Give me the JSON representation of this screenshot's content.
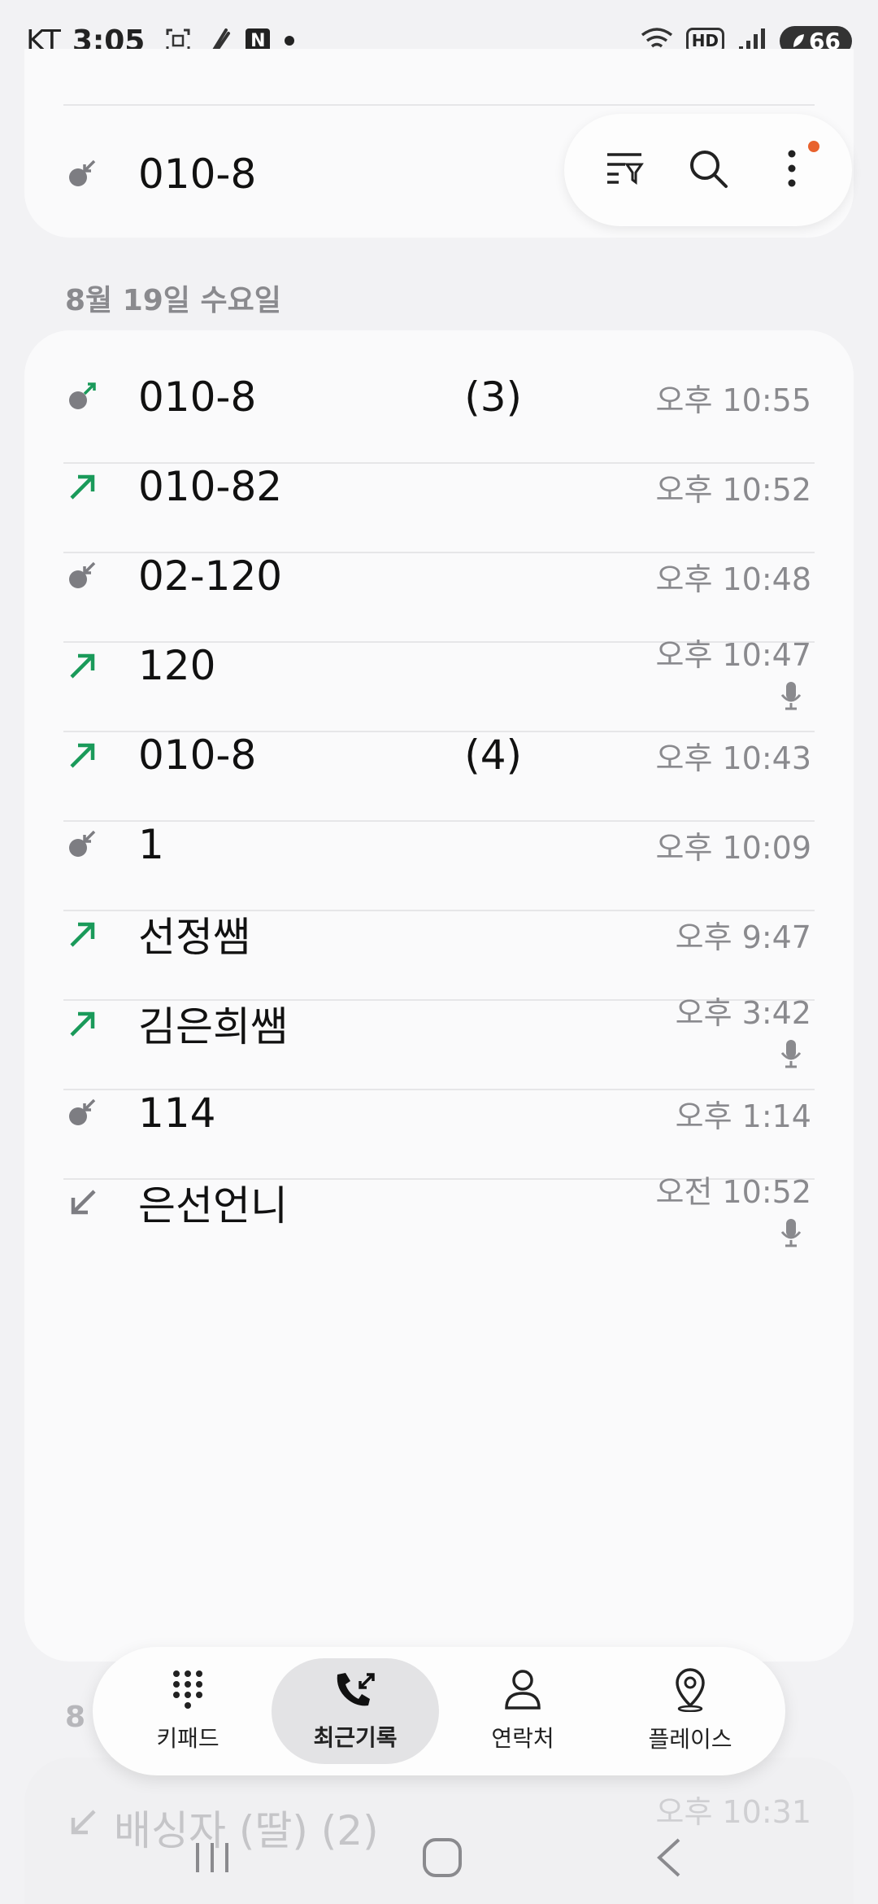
{
  "status_bar": {
    "carrier": "KT",
    "time": "3:05",
    "n_badge": "N",
    "wifi_label": "6",
    "hd_label": "HD",
    "battery": "66"
  },
  "top_card": {
    "visible_number": "010-8",
    "icon": "missed-message-call-icon"
  },
  "toolbar": {
    "icons": [
      "filter-icon",
      "search-icon",
      "more-options-icon"
    ],
    "notification_color": "#e8622d"
  },
  "section": {
    "date": "8월 19일 수요일"
  },
  "calls": [
    {
      "name": "010-8",
      "suffix": "(3)",
      "time": "오후 10:55",
      "type": "outgoing-message",
      "mic": false
    },
    {
      "name": "010-82",
      "suffix": "",
      "time": "오후 10:52",
      "type": "outgoing",
      "mic": false
    },
    {
      "name": "02-120",
      "suffix": "",
      "time": "오후 10:48",
      "type": "incoming-message",
      "mic": false
    },
    {
      "name": "120",
      "suffix": "",
      "time": "오후 10:47",
      "type": "outgoing",
      "mic": true
    },
    {
      "name": "010-8",
      "suffix": "(4)",
      "time": "오후 10:43",
      "type": "outgoing",
      "mic": false
    },
    {
      "name": "1",
      "suffix": "",
      "time": "오후 10:09",
      "type": "incoming-message",
      "mic": false
    },
    {
      "name": "선정쌤",
      "suffix": "",
      "time": "오후 9:47",
      "type": "outgoing",
      "mic": false
    },
    {
      "name": "김은희쌤",
      "suffix": "",
      "time": "오후 3:42",
      "type": "outgoing",
      "mic": true
    },
    {
      "name": "114",
      "suffix": "",
      "time": "오후 1:14",
      "type": "incoming-message",
      "mic": false
    },
    {
      "name": "은선언니",
      "suffix": "",
      "time": "오전 10:52",
      "type": "incoming",
      "mic": true
    }
  ],
  "bottom_peek": {
    "section_prefix": "8",
    "name": "배싱자 (딸) (2)",
    "time": "오후 10:31"
  },
  "bottom_nav": {
    "items": [
      {
        "label": "키패드",
        "icon": "keypad-icon",
        "active": false
      },
      {
        "label": "최근기록",
        "icon": "recent-calls-icon",
        "active": true
      },
      {
        "label": "연락처",
        "icon": "contacts-icon",
        "active": false
      },
      {
        "label": "플레이스",
        "icon": "places-icon",
        "active": false
      }
    ]
  },
  "colors": {
    "outgoing": "#1a9a5a",
    "incoming": "#7d7d82",
    "accent_dot": "#e8622d"
  }
}
